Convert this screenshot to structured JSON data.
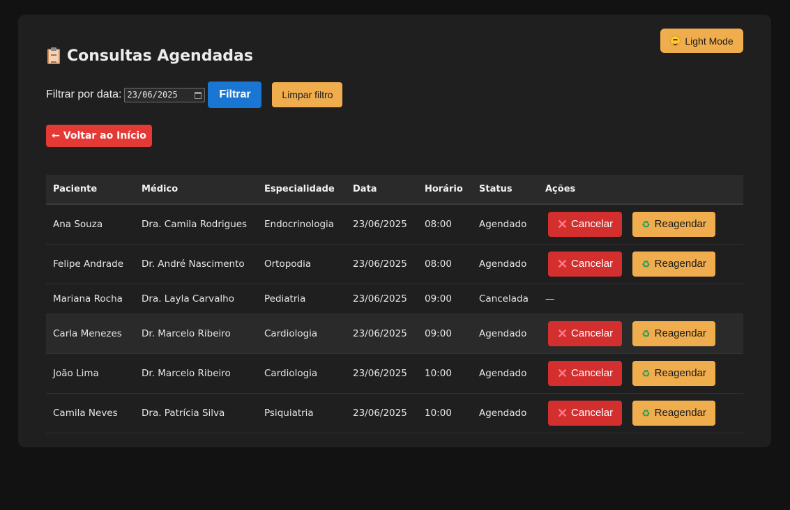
{
  "header": {
    "light_mode_label": "Light Mode",
    "title": "Consultas Agendadas"
  },
  "filter": {
    "label": "Filtrar por data:",
    "date_value": "23/06/2025",
    "filter_button": "Filtrar",
    "clear_button": "Limpar filtro"
  },
  "back_button": "← Voltar ao Início",
  "table": {
    "columns": [
      "Paciente",
      "Médico",
      "Especialidade",
      "Data",
      "Horário",
      "Status",
      "Ações"
    ],
    "rows": [
      {
        "paciente": "Ana Souza",
        "medico": "Dra. Camila Rodrigues",
        "especialidade": "Endocrinologia",
        "data": "23/06/2025",
        "horario": "08:00",
        "status": "Agendado"
      },
      {
        "paciente": "Felipe Andrade",
        "medico": "Dr. André Nascimento",
        "especialidade": "Ortopodia",
        "data": "23/06/2025",
        "horario": "08:00",
        "status": "Agendado"
      },
      {
        "paciente": "Mariana Rocha",
        "medico": "Dra. Layla Carvalho",
        "especialidade": "Pediatria",
        "data": "23/06/2025",
        "horario": "09:00",
        "status": "Cancelada",
        "no_actions": "—"
      },
      {
        "paciente": "Carla Menezes",
        "medico": "Dr. Marcelo Ribeiro",
        "especialidade": "Cardiologia",
        "data": "23/06/2025",
        "horario": "09:00",
        "status": "Agendado"
      },
      {
        "paciente": "João Lima",
        "medico": "Dr. Marcelo Ribeiro",
        "especialidade": "Cardiologia",
        "data": "23/06/2025",
        "horario": "10:00",
        "status": "Agendado"
      },
      {
        "paciente": "Camila Neves",
        "medico": "Dra. Patrícia Silva",
        "especialidade": "Psiquiatria",
        "data": "23/06/2025",
        "horario": "10:00",
        "status": "Agendado"
      }
    ],
    "cancel_label": "Cancelar",
    "reschedule_label": "Reagendar"
  }
}
